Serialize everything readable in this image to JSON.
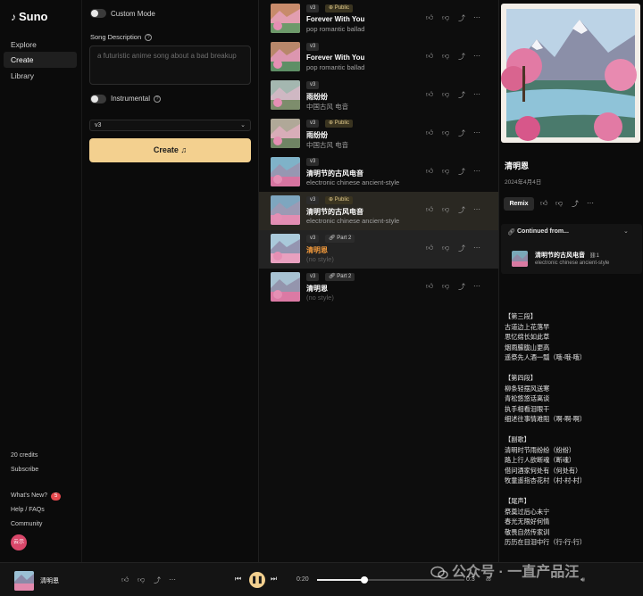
{
  "app": {
    "name": "Suno"
  },
  "nav": {
    "items": [
      {
        "label": "Explore",
        "active": false
      },
      {
        "label": "Create",
        "active": true
      },
      {
        "label": "Library",
        "active": false
      }
    ],
    "credits": "20 credits",
    "subscribe": "Subscribe",
    "whats_new": "What's New?",
    "whats_new_badge": "5",
    "help": "Help / FAQs",
    "community": "Community",
    "avatar": "云示"
  },
  "create": {
    "custom_mode_label": "Custom Mode",
    "song_description_label": "Song Description",
    "song_description_placeholder": "a futuristic anime song about a bad breakup",
    "instrumental_label": "Instrumental",
    "version": "v3",
    "create_button": "Create"
  },
  "songs": [
    {
      "version": "v3",
      "tag": "Public",
      "tag_type": "public",
      "title": "Forever With You",
      "style": "pop romantic ballad",
      "state": ""
    },
    {
      "version": "v3",
      "tag": "",
      "tag_type": "",
      "title": "Forever With You",
      "style": "pop romantic ballad",
      "state": ""
    },
    {
      "version": "v3",
      "tag": "",
      "tag_type": "",
      "title": "雨纷纷",
      "style": "中国古风 电音",
      "state": ""
    },
    {
      "version": "v3",
      "tag": "Public",
      "tag_type": "public",
      "title": "雨纷纷",
      "style": "中国古风 电音",
      "state": ""
    },
    {
      "version": "v3",
      "tag": "",
      "tag_type": "",
      "title": "清明节的古风电音",
      "style": "electronic chinese ancient-style",
      "state": ""
    },
    {
      "version": "v3",
      "tag": "Public",
      "tag_type": "public",
      "title": "清明节的古风电音",
      "style": "electronic chinese ancient-style",
      "state": "selected"
    },
    {
      "version": "v3",
      "tag": "Part 2",
      "tag_type": "part",
      "title": "清明恩",
      "style": "(no style)",
      "state": "playing"
    },
    {
      "version": "v3",
      "tag": "Part 2",
      "tag_type": "part",
      "title": "清明恩",
      "style": "(no style)",
      "state": ""
    }
  ],
  "detail": {
    "title": "清明恩",
    "date": "2024年4月4日",
    "remix": "Remix",
    "continued_from_label": "Continued from...",
    "continued_title": "清明节的古风电音",
    "continued_style": "electronic chinese ancient-style",
    "continued_count": "1",
    "lyrics": "【第三段】\n古道边上花落早\n思忆绵长如此草\n烟雨朦胧山更高\n遥祭先人酒一瓢（哦-哦-哦）\n\n【第四段】\n柳条轻摆风送寒\n青松悠悠话离谈\n执手相看泪眼干\n细述往事情难阻（啊-啊-啊）\n\n【副歌】\n清明时节雨纷纷（纷纷）\n路上行人欲断魂（断魂）\n借问酒家何处有（何处有）\n牧童遥指杏花村（村-村-村）\n\n【尾声】\n祭奠过后心未宁\n春光无限好何情\n敬畏自然传家训\n历历在目泪中行（行-行-行）"
  },
  "player": {
    "title": "清明恩",
    "time": "0:20",
    "duration": "0:3",
    "progress": 0.32
  },
  "watermark": "公众号 · 一直产品汪",
  "colors": {
    "accent": "#f3d08f",
    "playing_title": "#f39a3b",
    "badge": "#e5484d"
  }
}
